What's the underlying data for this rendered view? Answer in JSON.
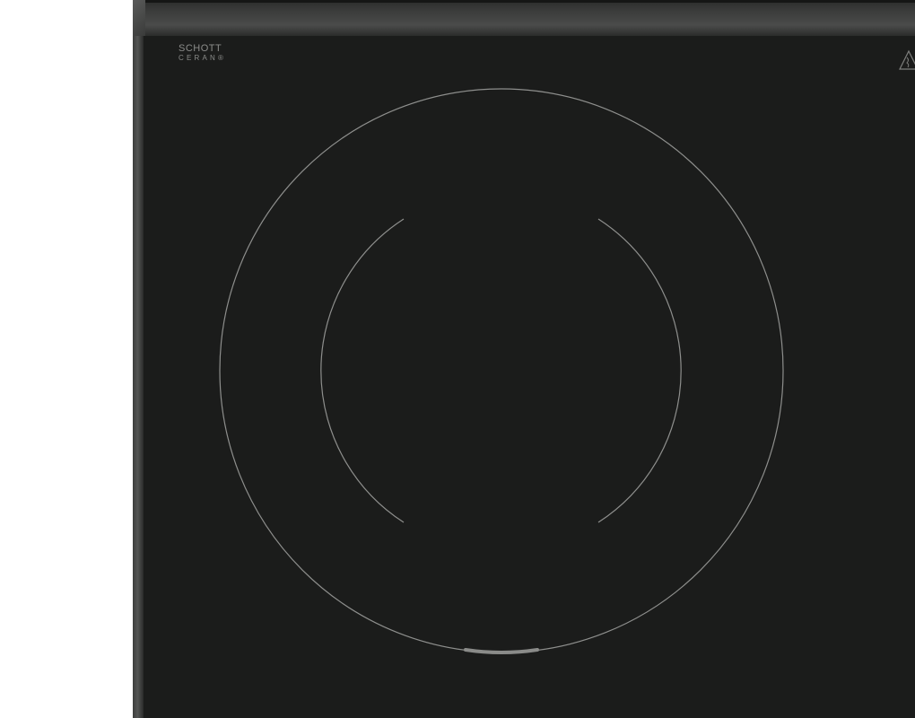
{
  "hob": {
    "brand_line1": "SCHOTT",
    "brand_line2": "CERAN®",
    "warning_icon": "hot-surface-warning-icon",
    "colors": {
      "glass": "#1b1c1b",
      "frame": "#4a4b4a",
      "zone_lines": "#8e8f8d",
      "indicator": "#8a8b89"
    }
  }
}
